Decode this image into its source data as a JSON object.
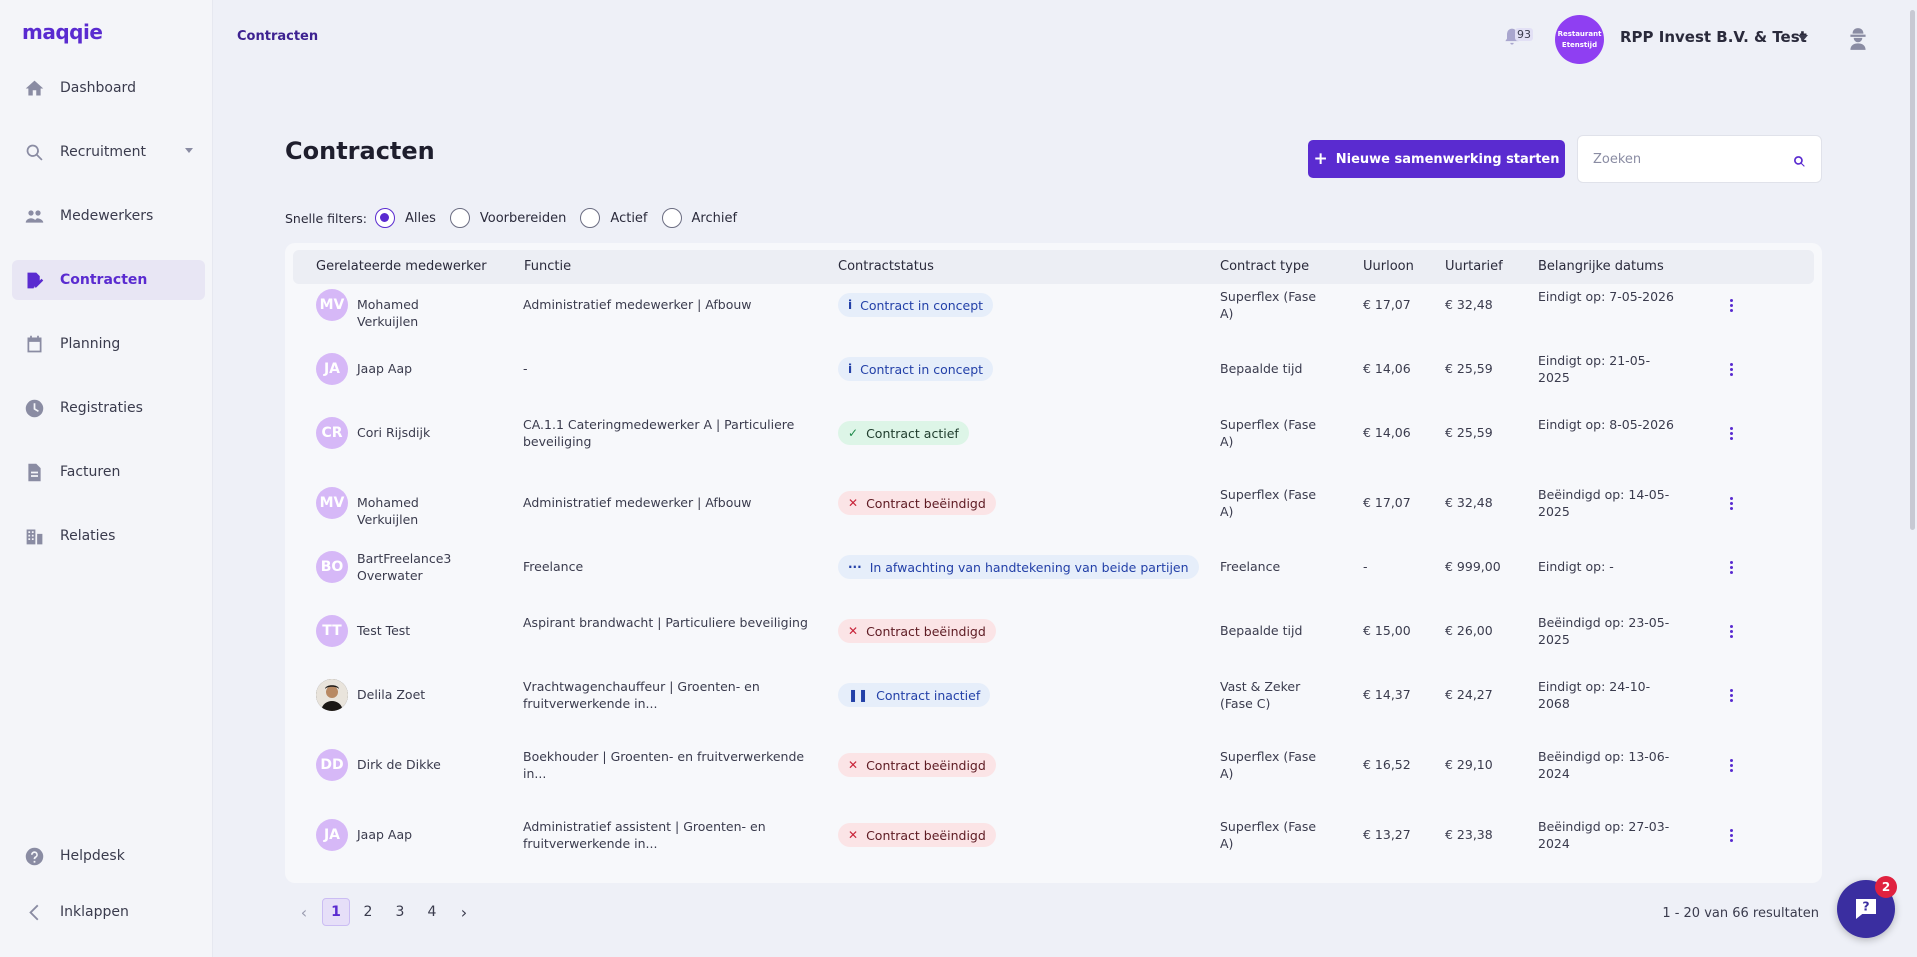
{
  "app": {
    "logo": "maqqie",
    "breadcrumb": "Contracten"
  },
  "sidebar": {
    "items": [
      {
        "label": "Dashboard",
        "icon": "home-icon"
      },
      {
        "label": "Recruitment",
        "icon": "search-icon"
      },
      {
        "label": "Medewerkers",
        "icon": "people-icon"
      },
      {
        "label": "Contracten",
        "icon": "contract-icon"
      },
      {
        "label": "Planning",
        "icon": "calendar-icon"
      },
      {
        "label": "Registraties",
        "icon": "clock-icon"
      },
      {
        "label": "Facturen",
        "icon": "document-icon"
      },
      {
        "label": "Relaties",
        "icon": "building-icon"
      }
    ],
    "bottom": [
      {
        "label": "Helpdesk",
        "icon": "help-icon"
      },
      {
        "label": "Inklappen",
        "icon": "chevron-left-icon"
      }
    ],
    "active": "Contracten"
  },
  "topbar": {
    "notifications_count": "93",
    "org_avatar_text": "Restaurant Etenstijd",
    "org_name": "RPP Invest B.V. & Test"
  },
  "page": {
    "title": "Contracten",
    "new_button": "Nieuwe samenwerking starten",
    "search_placeholder": "Zoeken"
  },
  "filters": {
    "label": "Snelle filters:",
    "options": [
      "Alles",
      "Voorbereiden",
      "Actief",
      "Archief"
    ],
    "selected": "Alles"
  },
  "table": {
    "columns": [
      "Gerelateerde medewerker",
      "Functie",
      "Contractstatus",
      "Contract type",
      "Uurloon",
      "Uurtarief",
      "Belangrijke datums"
    ],
    "rows": [
      {
        "initials": "MV",
        "name": "Mohamed Verkuijlen",
        "functie": "Administratief medewerker | Afbouw",
        "status": "Contract in concept",
        "status_kind": "concept",
        "type": "Superflex (Fase A)",
        "uurloon": "€ 17,07",
        "uurtarief": "€ 32,48",
        "datum": "Eindigt op: 7-05-2026"
      },
      {
        "initials": "JA",
        "name": "Jaap Aap",
        "functie": "-",
        "status": "Contract in concept",
        "status_kind": "concept",
        "type": "Bepaalde tijd",
        "uurloon": "€ 14,06",
        "uurtarief": "€ 25,59",
        "datum": "Eindigt op: 21-05-2025"
      },
      {
        "initials": "CR",
        "name": "Cori Rijsdijk",
        "functie": "CA.1.1 Cateringmedewerker A | Particuliere beveiliging",
        "status": "Contract actief",
        "status_kind": "actief",
        "type": "Superflex (Fase A)",
        "uurloon": "€ 14,06",
        "uurtarief": "€ 25,59",
        "datum": "Eindigt op: 8-05-2026"
      },
      {
        "initials": "MV",
        "name": "Mohamed Verkuijlen",
        "functie": "Administratief medewerker | Afbouw",
        "status": "Contract beëindigd",
        "status_kind": "beeindigd",
        "type": "Superflex (Fase A)",
        "uurloon": "€ 17,07",
        "uurtarief": "€ 32,48",
        "datum": "Beëindigd op: 14-05-2025"
      },
      {
        "initials": "BO",
        "name": "BartFreelance3 Overwater",
        "functie": "Freelance",
        "status": "In afwachting van handtekening van beide partijen",
        "status_kind": "wait",
        "type": "Freelance",
        "uurloon": "-",
        "uurtarief": "€ 999,00",
        "datum": "Eindigt op: -"
      },
      {
        "initials": "TT",
        "name": "Test Test",
        "functie": "Aspirant brandwacht | Particuliere beveiliging",
        "status": "Contract beëindigd",
        "status_kind": "beeindigd",
        "type": "Bepaalde tijd",
        "uurloon": "€ 15,00",
        "uurtarief": "€ 26,00",
        "datum": "Beëindigd op: 23-05-2025"
      },
      {
        "initials": "",
        "name": "Delila Zoet",
        "functie": "Vrachtwagenchauffeur | Groenten- en fruitverwerkende in...",
        "status": "Contract inactief",
        "status_kind": "inactief",
        "type": "Vast & Zeker (Fase C)",
        "uurloon": "€ 14,37",
        "uurtarief": "€ 24,27",
        "datum": "Eindigt op: 24-10-2068"
      },
      {
        "initials": "DD",
        "name": "Dirk de Dikke",
        "functie": "Boekhouder | Groenten- en fruitverwerkende in...",
        "status": "Contract beëindigd",
        "status_kind": "beeindigd",
        "type": "Superflex (Fase A)",
        "uurloon": "€ 16,52",
        "uurtarief": "€ 29,10",
        "datum": "Beëindigd op: 13-06-2024"
      },
      {
        "initials": "JA",
        "name": "Jaap Aap",
        "functie": "Administratief assistent | Groenten- en fruitverwerkende in...",
        "status": "Contract beëindigd",
        "status_kind": "beeindigd",
        "type": "Superflex (Fase A)",
        "uurloon": "€ 13,27",
        "uurtarief": "€ 23,38",
        "datum": "Beëindigd op: 27-03-2024"
      }
    ]
  },
  "pagination": {
    "pages": [
      "1",
      "2",
      "3",
      "4"
    ],
    "current": "1",
    "results": "1 - 20 van 66 resultaten"
  },
  "help_widget": {
    "badge": "2"
  },
  "colors": {
    "brand": "#5a2bd0",
    "ended": "#c8243a",
    "active": "#1f8a4c"
  }
}
